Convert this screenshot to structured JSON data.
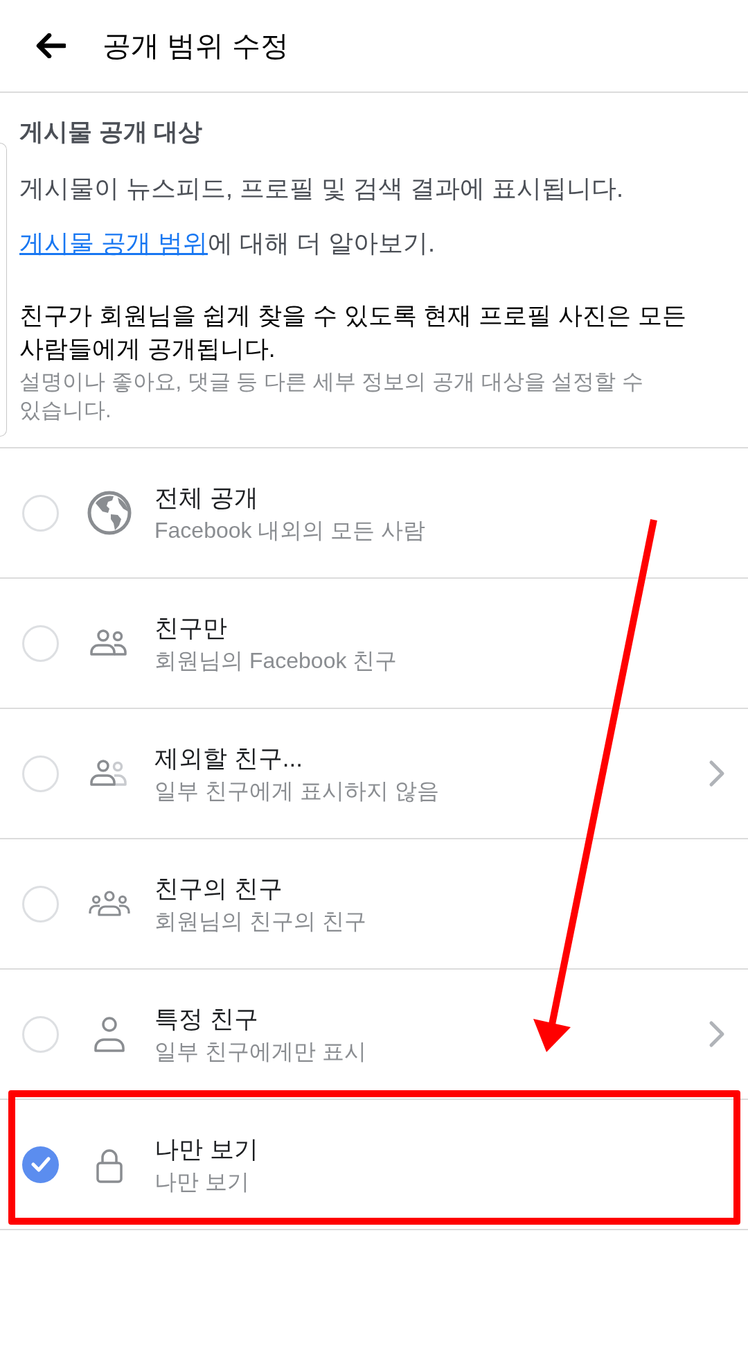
{
  "header": {
    "title": "공개 범위 수정"
  },
  "intro": {
    "heading": "게시물 공개 대상",
    "description": "게시물이 뉴스피드, 프로필 및 검색 결과에 표시됩니다.",
    "learn_more": {
      "link": "게시물 공개 범위",
      "text": "에 대해 더 알아보기."
    },
    "notice": "친구가 회원님을 쉽게 찾을 수 있도록 현재 프로필 사진은 모든 사람들에게 공개됩니다.",
    "note": "설명이나 좋아요, 댓글 등 다른 세부 정보의 공개 대상을 설정할 수 있습니다."
  },
  "options": [
    {
      "kind": "public",
      "title": "전체 공개",
      "subtitle": "Facebook 내외의 모든 사람",
      "selected": false,
      "has_submenu": false,
      "highlighted": false
    },
    {
      "kind": "friends",
      "title": "친구만",
      "subtitle": "회원님의 Facebook 친구",
      "selected": false,
      "has_submenu": false,
      "highlighted": false
    },
    {
      "kind": "friends_except",
      "title": "제외할 친구...",
      "subtitle": "일부 친구에게 표시하지 않음",
      "selected": false,
      "has_submenu": true,
      "highlighted": false
    },
    {
      "kind": "friends_of_friends",
      "title": "친구의 친구",
      "subtitle": "회원님의 친구의 친구",
      "selected": false,
      "has_submenu": false,
      "highlighted": false
    },
    {
      "kind": "specific_friends",
      "title": "특정 친구",
      "subtitle": "일부 친구에게만 표시",
      "selected": false,
      "has_submenu": true,
      "highlighted": false
    },
    {
      "kind": "only_me",
      "title": "나만 보기",
      "subtitle": "나만 보기",
      "selected": true,
      "has_submenu": false,
      "highlighted": true
    }
  ],
  "annotations": [
    {
      "kind": "arrow"
    }
  ]
}
